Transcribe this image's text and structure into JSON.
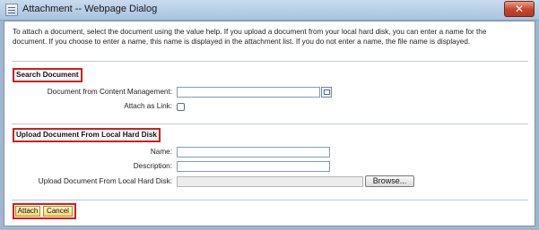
{
  "window": {
    "title": "Attachment -- Webpage Dialog",
    "close_glyph": "✕"
  },
  "intro_text": "To attach a document, select the document using the value help. If you upload a document from your local hard disk, you can enter a name for the document. If you choose to enter a name, this name is displayed in the attachment list. If you do not enter a name, the file name is displayed.",
  "search_section": {
    "title": "Search Document",
    "document_label": "Document from Content Management:",
    "document_value": "",
    "attach_link_label": "Attach as Link:",
    "attach_link_checked": false
  },
  "upload_section": {
    "title": "Upload Document From Local Hard Disk",
    "name_label": "Name:",
    "name_value": "",
    "description_label": "Description:",
    "description_value": "",
    "file_label": "Upload Document From Local Hard Disk:",
    "file_value": "",
    "browse_label": "Browse..."
  },
  "actions": {
    "attach_label": "Attach",
    "cancel_label": "Cancel"
  },
  "colors": {
    "highlight": "#d41c1c",
    "button_fill": "#f2d86d"
  }
}
